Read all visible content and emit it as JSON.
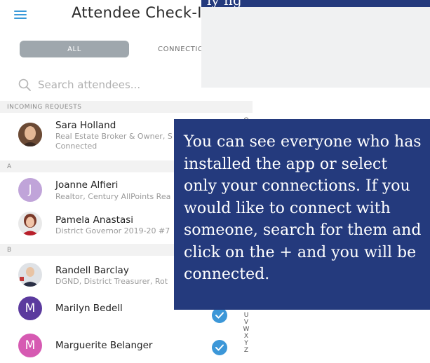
{
  "header": {
    "title": "Attendee Check-In"
  },
  "segmented": {
    "all_label": "ALL",
    "connections_label": "CONNECTIC"
  },
  "search": {
    "placeholder": "Search attendees..."
  },
  "sections": {
    "incoming": "INCOMING REQUESTS",
    "a": "A",
    "b": "B"
  },
  "attendees": [
    {
      "name": "Sara Holland",
      "subtitle": "Real Estate Broker & Owner, S",
      "status": "Connected"
    },
    {
      "name": "Joanne Alfieri",
      "subtitle": "Realtor, Century AllPoints Rea",
      "initial": "J"
    },
    {
      "name": "Pamela Anastasi",
      "subtitle": "District Governor 2019-20 #7"
    },
    {
      "name": "Randell Barclay",
      "subtitle": "DGND, District Treasurer, Rot"
    },
    {
      "name": "Marilyn Bedell",
      "initial": "M"
    },
    {
      "name": "Marguerite Belanger",
      "initial": "M"
    }
  ],
  "alphabet_index": [
    "O",
    "U",
    "V",
    "W",
    "X",
    "Y",
    "Z"
  ],
  "top_banner_fragment": "ly                 ng",
  "callout": {
    "text": "You can see everyone who has installed the app or select only your connections. If you would like to connect with someone, search for them and click on the + and you will be connected."
  },
  "colors": {
    "accent_blue": "#3c97d8",
    "callout_bg": "#243a7d",
    "segment_active": "#9fa7ad",
    "avatar_lavender": "#c0a4d9",
    "avatar_purple": "#5b3a9e",
    "avatar_pink": "#d65ab2"
  }
}
